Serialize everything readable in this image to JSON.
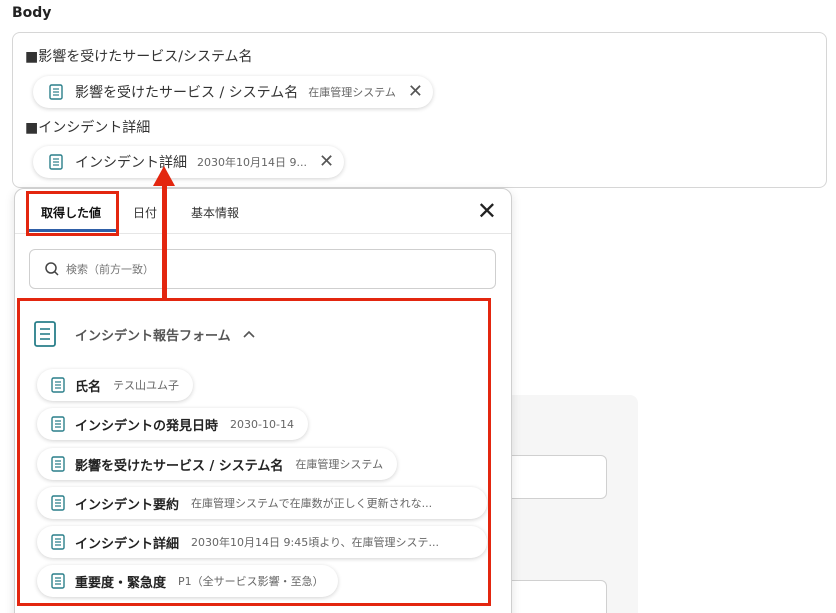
{
  "body_label": "Body",
  "editor": {
    "line1": "■影響を受けたサービス/システム名",
    "chip1": {
      "title": "影響を受けたサービス / システム名",
      "value": "在庫管理システム"
    },
    "line2": "■インシデント詳細",
    "chip2": {
      "title": "インシデント詳細",
      "value": "2030年10月14日 9..."
    }
  },
  "popup": {
    "tabs": [
      {
        "label": "取得した値"
      },
      {
        "label": "日付"
      },
      {
        "label": "基本情報"
      }
    ],
    "search_placeholder": "検索（前方一致）",
    "section_title": "インシデント報告フォーム",
    "items": [
      {
        "title": "氏名",
        "value": "テス山ユム子"
      },
      {
        "title": "インシデントの発見日時",
        "value": "2030-10-14"
      },
      {
        "title": "影響を受けたサービス / システム名",
        "value": "在庫管理システム"
      },
      {
        "title": "インシデント要約",
        "value": "在庫管理システムで在庫数が正しく更新されな..."
      },
      {
        "title": "インシデント詳細",
        "value": "2030年10月14日 9:45頃より、在庫管理システ..."
      },
      {
        "title": "重要度・緊急度",
        "value": "P1（全サービス影響・至急）"
      }
    ]
  },
  "colors": {
    "accent_underline": "#2f5fa7",
    "annotation_red": "#e3260f",
    "icon_teal": "#2a7f8a"
  }
}
